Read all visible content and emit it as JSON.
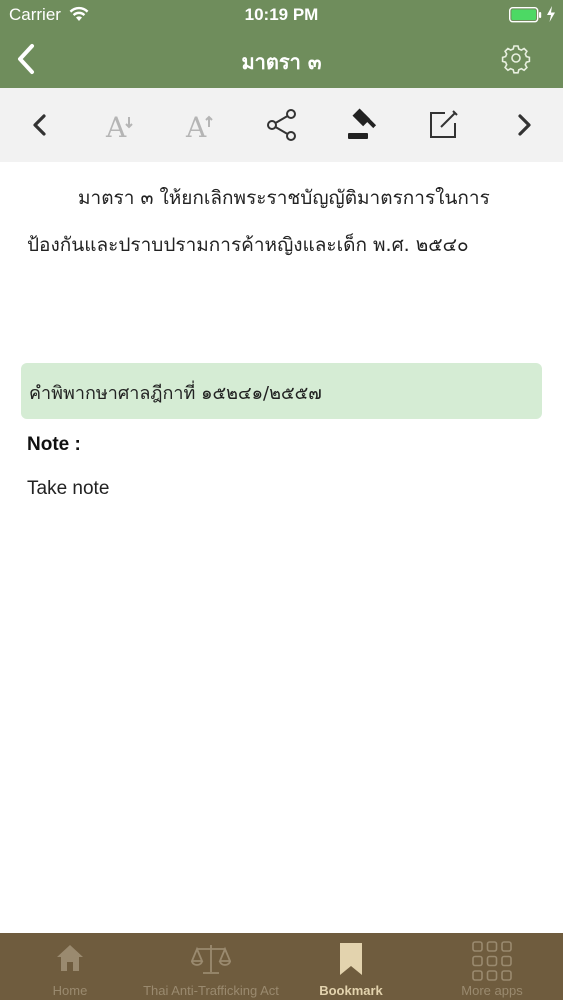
{
  "status_bar": {
    "carrier": "Carrier",
    "time": "10:19 PM"
  },
  "nav": {
    "title": "มาตรา ๓"
  },
  "content": {
    "law_text": "มาตรา ๓ ให้ยกเลิกพระราชบัญญัติมาตรการในการป้องกันและปราบปรามการค้าหญิงและเด็ก พ.ศ. ๒๕๔๐",
    "judgment_ref": "คำพิพากษาศาลฎีกาที่ ๑๕๒๔๑/๒๕๕๗",
    "note_label": "Note :",
    "note_placeholder": "Take note"
  },
  "tabs": [
    {
      "label": "Home",
      "icon": "home-icon"
    },
    {
      "label": "Thai Anti-Trafficking Act",
      "icon": "scales-icon"
    },
    {
      "label": "Bookmark",
      "icon": "bookmark-icon",
      "active": true
    },
    {
      "label": "More apps",
      "icon": "grid-icon"
    }
  ],
  "colors": {
    "header": "#6f8d5c",
    "toolbar": "#f2f2f2",
    "judgment_box": "#d5ecd4",
    "tab_bar": "#6f5c3e"
  }
}
